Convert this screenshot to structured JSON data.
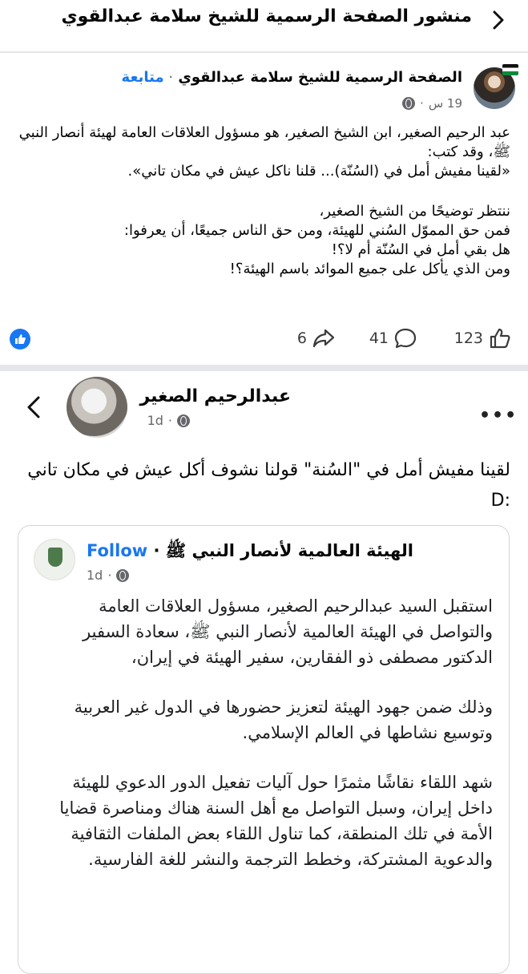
{
  "header": {
    "title": "منشور الصفحة الرسمية للشيخ سلامة عبدالقوي"
  },
  "post": {
    "page_name": "الصفحة الرسمية للشيخ سلامة عبدالقوي",
    "follow_label": "متابعة",
    "time": "19 س",
    "body_p1": "عبد الرحيم الصغير، ابن الشيخ الصغير، هو مسؤول العلاقات العامة لهيئة أنصار النبي ﷺ، وقد كتب:",
    "body_p2": "«لقينا مفيش أمل في (السُنّة)... قلنا ناكل عيش في مكان تاني».",
    "body_p3": "ننتظر توضيحًا من الشيخ الصغير،",
    "body_p4": "فمن حق المموّل السُني للهيئة، ومن حق الناس جميعًا، أن يعرفوا:",
    "body_p5": "هل بقي أمل في السُنّة أم لا؟!",
    "body_p6": "ومن الذي يأكل على جميع الموائد باسم الهيئة؟!",
    "likes": "123",
    "comments": "41",
    "shares": "6"
  },
  "embedded": {
    "author": "عبدالرحيم الصغير",
    "time": "1d",
    "text": "لقينا مفيش أمل في \"السُنة\" قولنا نشوف أكل عيش في مكان تاني :D",
    "shared": {
      "page_name": "الهيئة العالمية لأنصار النبي ﷺ",
      "follow_label": "Follow",
      "time": "1d",
      "p1": "استقبل السيد عبدالرحيم الصغير، مسؤول العلاقات العامة والتواصل في الهيئة العالمية لأنصار النبي ﷺ، سعادة السفير الدكتور مصطفى ذو الفقارين، سفير الهيئة في إيران،",
      "p2": "وذلك ضمن جهود الهيئة لتعزيز حضورها في الدول غير العربية وتوسيع نشاطها في العالم الإسلامي.",
      "p3": "شهد اللقاء نقاشًا مثمرًا حول آليات تفعيل الدور الدعوي للهيئة داخل إيران، وسبل التواصل مع أهل السنة هناك ومناصرة قضايا الأمة في تلك المنطقة، كما تناول اللقاء بعض الملفات الثقافية والدعوية المشتركة، وخطط الترجمة والنشر للغة الفارسية."
    }
  },
  "icons": {
    "back": "chevron-right-icon",
    "embedded_back": "chevron-left-icon",
    "like": "thumbs-up-icon",
    "comment": "comment-icon",
    "share": "share-icon",
    "privacy": "globe-icon",
    "more": "more-dots-icon"
  },
  "colors": {
    "accent": "#1877f2",
    "meta": "#65676b",
    "text": "#050505",
    "divider": "#e4e6eb"
  }
}
